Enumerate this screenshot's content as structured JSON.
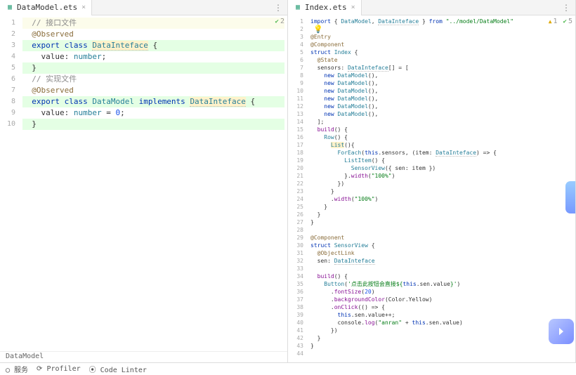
{
  "left": {
    "tab": {
      "filename": "DataModel.ets"
    },
    "annotations": [
      {
        "cls": "badge-ok",
        "text": "2"
      }
    ],
    "breadcrumb": "DataModel",
    "lines": [
      {
        "n": 1,
        "cls": "caret-line",
        "tokens": [
          {
            "t": "  "
          },
          {
            "t": "// 接口文件",
            "c": "tok-cmt"
          }
        ]
      },
      {
        "n": 2,
        "tokens": [
          {
            "t": "  "
          },
          {
            "t": "@Observed",
            "c": "tok-deco"
          }
        ]
      },
      {
        "n": 3,
        "cls": "hl-green",
        "tokens": [
          {
            "t": "  "
          },
          {
            "t": "export class ",
            "c": "tok-kw"
          },
          {
            "t": "DataInteface",
            "c": "tok-cls hl-yellow underline-squiggle"
          },
          {
            "t": " {"
          }
        ]
      },
      {
        "n": 4,
        "tokens": [
          {
            "t": "    value"
          },
          {
            "t": ": "
          },
          {
            "t": "number",
            "c": "tok-type"
          },
          {
            "t": ";"
          }
        ]
      },
      {
        "n": 5,
        "cls": "hl-green",
        "tokens": [
          {
            "t": "  }"
          }
        ]
      },
      {
        "n": 6,
        "tokens": [
          {
            "t": "  "
          },
          {
            "t": "// 实现文件",
            "c": "tok-cmt"
          }
        ]
      },
      {
        "n": 7,
        "tokens": [
          {
            "t": "  "
          },
          {
            "t": "@Observed",
            "c": "tok-deco"
          }
        ]
      },
      {
        "n": 8,
        "cls": "hl-green",
        "tokens": [
          {
            "t": "  "
          },
          {
            "t": "export class ",
            "c": "tok-kw"
          },
          {
            "t": "DataModel",
            "c": "tok-cls"
          },
          {
            "t": " implements ",
            "c": "tok-kw"
          },
          {
            "t": "DataInteface",
            "c": "tok-cls hl-yellow underline-squiggle"
          },
          {
            "t": " {"
          }
        ]
      },
      {
        "n": 9,
        "tokens": [
          {
            "t": "    value"
          },
          {
            "t": ": "
          },
          {
            "t": "number",
            "c": "tok-type"
          },
          {
            "t": " = "
          },
          {
            "t": "0",
            "c": "tok-num"
          },
          {
            "t": ";"
          }
        ]
      },
      {
        "n": 10,
        "cls": "hl-green",
        "tokens": [
          {
            "t": "  }"
          }
        ]
      }
    ]
  },
  "right": {
    "tab": {
      "filename": "Index.ets"
    },
    "annotations": [
      {
        "cls": "badge-warn",
        "text": "1"
      },
      {
        "cls": "badge-ok",
        "text": "5"
      }
    ],
    "lines": [
      {
        "n": 1,
        "tokens": [
          {
            "t": "import ",
            "c": "tok-kw"
          },
          {
            "t": "{ "
          },
          {
            "t": "DataModel",
            "c": "tok-cls"
          },
          {
            "t": ", "
          },
          {
            "t": "DataInteface",
            "c": "tok-cls underline-squiggle"
          },
          {
            "t": " } "
          },
          {
            "t": "from ",
            "c": "tok-kw"
          },
          {
            "t": "\"../model/DataModel\"",
            "c": "tok-str"
          }
        ]
      },
      {
        "n": 2,
        "tokens": [
          {
            "t": "💡",
            "c": "bulb"
          }
        ]
      },
      {
        "n": 3,
        "tokens": [
          {
            "t": "@Entry",
            "c": "tok-deco"
          }
        ]
      },
      {
        "n": 4,
        "tokens": [
          {
            "t": "@Component",
            "c": "tok-deco"
          }
        ]
      },
      {
        "n": 5,
        "tokens": [
          {
            "t": "struct ",
            "c": "tok-kw"
          },
          {
            "t": "Index",
            "c": "tok-cls"
          },
          {
            "t": " {"
          }
        ]
      },
      {
        "n": 6,
        "tokens": [
          {
            "t": "  "
          },
          {
            "t": "@State",
            "c": "tok-deco"
          }
        ]
      },
      {
        "n": 7,
        "tokens": [
          {
            "t": "  sensors: "
          },
          {
            "t": "DataInteface",
            "c": "tok-cls underline-squiggle"
          },
          {
            "t": "[] = ["
          }
        ]
      },
      {
        "n": 8,
        "tokens": [
          {
            "t": "    "
          },
          {
            "t": "new ",
            "c": "tok-kw"
          },
          {
            "t": "DataModel",
            "c": "tok-cls"
          },
          {
            "t": "(),"
          }
        ]
      },
      {
        "n": 9,
        "tokens": [
          {
            "t": "    "
          },
          {
            "t": "new ",
            "c": "tok-kw"
          },
          {
            "t": "DataModel",
            "c": "tok-cls"
          },
          {
            "t": "(),"
          }
        ]
      },
      {
        "n": 10,
        "tokens": [
          {
            "t": "    "
          },
          {
            "t": "new ",
            "c": "tok-kw"
          },
          {
            "t": "DataModel",
            "c": "tok-cls"
          },
          {
            "t": "(),"
          }
        ]
      },
      {
        "n": 11,
        "tokens": [
          {
            "t": "    "
          },
          {
            "t": "new ",
            "c": "tok-kw"
          },
          {
            "t": "DataModel",
            "c": "tok-cls"
          },
          {
            "t": "(),"
          }
        ]
      },
      {
        "n": 12,
        "tokens": [
          {
            "t": "    "
          },
          {
            "t": "new ",
            "c": "tok-kw"
          },
          {
            "t": "DataModel",
            "c": "tok-cls"
          },
          {
            "t": "(),"
          }
        ]
      },
      {
        "n": 13,
        "tokens": [
          {
            "t": "    "
          },
          {
            "t": "new ",
            "c": "tok-kw"
          },
          {
            "t": "DataModel",
            "c": "tok-cls"
          },
          {
            "t": "(),"
          }
        ]
      },
      {
        "n": 14,
        "tokens": [
          {
            "t": "  ];"
          }
        ]
      },
      {
        "n": 15,
        "tokens": [
          {
            "t": "  "
          },
          {
            "t": "build",
            "c": "tok-ref"
          },
          {
            "t": "() {"
          }
        ]
      },
      {
        "n": 16,
        "tokens": [
          {
            "t": "    "
          },
          {
            "t": "Row",
            "c": "tok-cls"
          },
          {
            "t": "() {"
          }
        ]
      },
      {
        "n": 17,
        "tokens": [
          {
            "t": "      "
          },
          {
            "t": "List",
            "c": "tok-cls hl-yellow"
          },
          {
            "t": "(){"
          }
        ]
      },
      {
        "n": 18,
        "tokens": [
          {
            "t": "        "
          },
          {
            "t": "ForEach",
            "c": "tok-cls"
          },
          {
            "t": "("
          },
          {
            "t": "this",
            "c": "tok-kw"
          },
          {
            "t": ".sensors, (item: "
          },
          {
            "t": "DataInteface",
            "c": "tok-cls underline-squiggle"
          },
          {
            "t": ") => {"
          }
        ]
      },
      {
        "n": 19,
        "tokens": [
          {
            "t": "          "
          },
          {
            "t": "ListItem",
            "c": "tok-cls"
          },
          {
            "t": "() {"
          }
        ]
      },
      {
        "n": 20,
        "tokens": [
          {
            "t": "            "
          },
          {
            "t": "SensorView",
            "c": "tok-cls"
          },
          {
            "t": "({ sen: item })"
          }
        ]
      },
      {
        "n": 21,
        "tokens": [
          {
            "t": "          }."
          },
          {
            "t": "width",
            "c": "tok-ref"
          },
          {
            "t": "("
          },
          {
            "t": "\"100%\"",
            "c": "tok-str"
          },
          {
            "t": ")"
          }
        ]
      },
      {
        "n": 22,
        "tokens": [
          {
            "t": "        })"
          }
        ]
      },
      {
        "n": 23,
        "tokens": [
          {
            "t": "      }"
          }
        ]
      },
      {
        "n": 24,
        "tokens": [
          {
            "t": "      ."
          },
          {
            "t": "width",
            "c": "tok-ref"
          },
          {
            "t": "("
          },
          {
            "t": "\"100%\"",
            "c": "tok-str"
          },
          {
            "t": ")"
          }
        ]
      },
      {
        "n": 25,
        "tokens": [
          {
            "t": "    }"
          }
        ]
      },
      {
        "n": 26,
        "tokens": [
          {
            "t": "  }"
          }
        ]
      },
      {
        "n": 27,
        "tokens": [
          {
            "t": "}"
          }
        ]
      },
      {
        "n": 28,
        "tokens": [
          {
            "t": ""
          }
        ]
      },
      {
        "n": 29,
        "tokens": [
          {
            "t": "@Component",
            "c": "tok-deco"
          }
        ]
      },
      {
        "n": 30,
        "tokens": [
          {
            "t": "struct ",
            "c": "tok-kw"
          },
          {
            "t": "SensorView",
            "c": "tok-cls"
          },
          {
            "t": " {"
          }
        ]
      },
      {
        "n": 31,
        "tokens": [
          {
            "t": "  "
          },
          {
            "t": "@ObjectLink",
            "c": "tok-deco"
          }
        ]
      },
      {
        "n": 32,
        "tokens": [
          {
            "t": "  sen: "
          },
          {
            "t": "DataInteface",
            "c": "tok-cls underline-squiggle"
          }
        ]
      },
      {
        "n": 33,
        "tokens": [
          {
            "t": ""
          }
        ]
      },
      {
        "n": 34,
        "tokens": [
          {
            "t": "  "
          },
          {
            "t": "build",
            "c": "tok-ref"
          },
          {
            "t": "() {"
          }
        ]
      },
      {
        "n": 35,
        "tokens": [
          {
            "t": "    "
          },
          {
            "t": "Button",
            "c": "tok-cls"
          },
          {
            "t": "("
          },
          {
            "t": "'点击此按钮会直接${",
            "c": "tok-str"
          },
          {
            "t": "this",
            "c": "tok-kw"
          },
          {
            "t": ".sen.value"
          },
          {
            "t": "}'",
            "c": "tok-str"
          },
          {
            "t": ")"
          }
        ]
      },
      {
        "n": 36,
        "tokens": [
          {
            "t": "      ."
          },
          {
            "t": "fontSize",
            "c": "tok-ref"
          },
          {
            "t": "("
          },
          {
            "t": "20",
            "c": "tok-num"
          },
          {
            "t": ")"
          }
        ]
      },
      {
        "n": 37,
        "tokens": [
          {
            "t": "      ."
          },
          {
            "t": "backgroundColor",
            "c": "tok-ref"
          },
          {
            "t": "(Color.Yellow)"
          }
        ]
      },
      {
        "n": 38,
        "tokens": [
          {
            "t": "      ."
          },
          {
            "t": "onClick",
            "c": "tok-ref"
          },
          {
            "t": "(() => {"
          }
        ]
      },
      {
        "n": 39,
        "tokens": [
          {
            "t": "        "
          },
          {
            "t": "this",
            "c": "tok-kw"
          },
          {
            "t": ".sen.value++;"
          }
        ]
      },
      {
        "n": 40,
        "tokens": [
          {
            "t": "        console."
          },
          {
            "t": "log",
            "c": "tok-ref"
          },
          {
            "t": "("
          },
          {
            "t": "\"anran\"",
            "c": "tok-str"
          },
          {
            "t": " + "
          },
          {
            "t": "this",
            "c": "tok-kw"
          },
          {
            "t": ".sen.value)"
          }
        ]
      },
      {
        "n": 41,
        "tokens": [
          {
            "t": "      })"
          }
        ]
      },
      {
        "n": 42,
        "tokens": [
          {
            "t": "  }"
          }
        ]
      },
      {
        "n": 43,
        "tokens": [
          {
            "t": "}"
          }
        ]
      },
      {
        "n": 44,
        "tokens": [
          {
            "t": ""
          }
        ]
      }
    ]
  },
  "status": {
    "services": "服务",
    "profiler": "Profiler",
    "linter": "Code Linter"
  }
}
